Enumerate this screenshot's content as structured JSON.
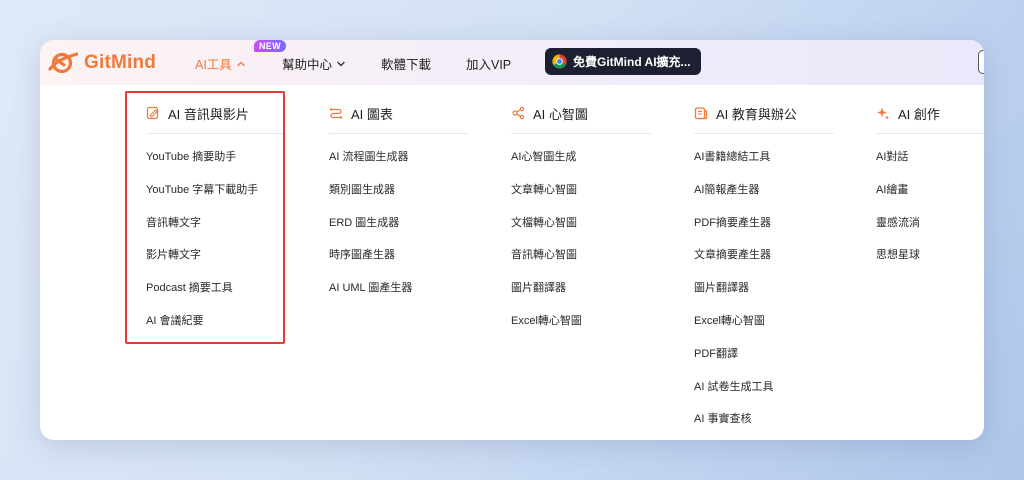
{
  "brand": {
    "name": "GitMind",
    "color": "#f07a3c"
  },
  "nav": {
    "items": [
      {
        "label": "AI工具",
        "active": true,
        "has_chevron": true,
        "chevron": "chevron-up-icon"
      },
      {
        "label": "幫助中心",
        "active": false,
        "has_chevron": true,
        "chevron": "chevron-down-icon"
      },
      {
        "label": "軟體下載",
        "active": false,
        "has_chevron": false
      },
      {
        "label": "加入VIP",
        "active": false,
        "has_chevron": false
      }
    ],
    "badge": "NEW",
    "cta_label": "免費GitMind AI擴充...",
    "cta_icon": "chrome-icon"
  },
  "menu": {
    "columns": [
      {
        "heading": "AI 音訊與影片",
        "icon": "edit-document-icon",
        "items": [
          "YouTube 摘要助手",
          "YouTube 字幕下載助手",
          "音訊轉文字",
          "影片轉文字",
          "Podcast 摘要工具",
          "AI 會議紀要"
        ]
      },
      {
        "heading": "AI 圖表",
        "icon": "flowchart-icon",
        "items": [
          "AI 流程圖生成器",
          "類別圖生成器",
          "ERD 圖生成器",
          "時序圖產生器",
          "AI UML 圖產生器"
        ]
      },
      {
        "heading": "AI 心智圖",
        "icon": "mindmap-icon",
        "items": [
          "AI心智圖生成",
          "文章轉心智圖",
          "文檔轉心智圖",
          "音訊轉心智圖",
          "圖片翻譯器",
          "Excel轉心智圖"
        ]
      },
      {
        "heading": "AI 教育與辦公",
        "icon": "book-icon",
        "items": [
          "AI書籍總結工具",
          "AI簡報產生器",
          "PDF摘要產生器",
          "文章摘要產生器",
          "圖片翻譯器",
          "Excel轉心智圖",
          "PDF翻譯",
          "AI 試卷生成工具",
          "AI 事實查核"
        ]
      },
      {
        "heading": "AI 創作",
        "icon": "sparkle-icon",
        "items": [
          "AI對話",
          "AI繪畫",
          "靈感流淌",
          "思想星球"
        ]
      }
    ],
    "highlight_color": "#e83a3a"
  }
}
